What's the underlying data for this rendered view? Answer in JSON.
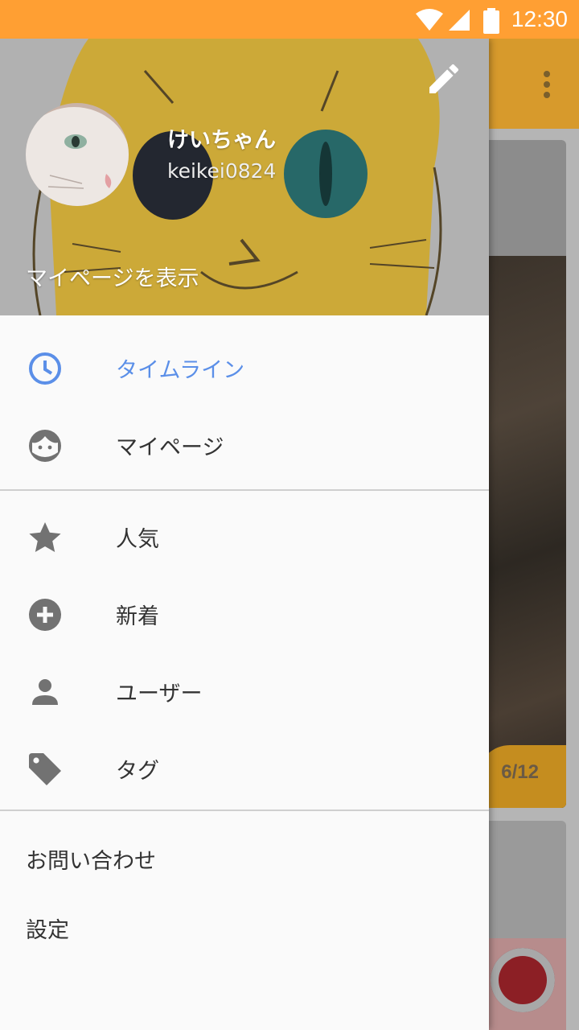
{
  "status_bar": {
    "time": "12:30",
    "background": "#ff9f33",
    "icons": [
      "wifi-icon",
      "cell-signal-icon",
      "battery-icon"
    ]
  },
  "drawer": {
    "user_name": "けいちゃん",
    "user_id": "keikei0824",
    "view_mypage": "マイページを表示",
    "primary_items": [
      {
        "label": "タイムライン",
        "icon": "clock-icon",
        "active": true
      },
      {
        "label": "マイページ",
        "icon": "face-icon",
        "active": false
      }
    ],
    "browse_items": [
      {
        "label": "人気",
        "icon": "star-icon"
      },
      {
        "label": "新着",
        "icon": "add-circle-icon"
      },
      {
        "label": "ユーザー",
        "icon": "person-icon"
      },
      {
        "label": "タグ",
        "icon": "tag-icon"
      }
    ],
    "footer_items": [
      {
        "label": "お問い合わせ"
      },
      {
        "label": "設定"
      }
    ],
    "accent_color": "#5b8fe8"
  },
  "background_app": {
    "image_counter": "6/12"
  }
}
